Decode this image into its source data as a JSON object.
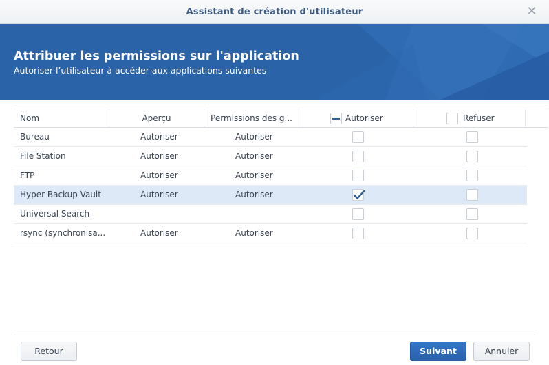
{
  "window": {
    "title": "Assistant de création d'utilisateur",
    "close_icon": "close-icon"
  },
  "banner": {
    "title": "Attribuer les permissions sur l'application",
    "subtitle": "Autoriser l’utilisateur à accéder aux applications suivantes",
    "color": "#2a63a8"
  },
  "table": {
    "headers": {
      "name": "Nom",
      "apercu": "Aperçu",
      "group_permissions": "Permissions des g...",
      "allow": "Autoriser",
      "deny": "Refuser"
    },
    "header_allow_state": "indeterminate",
    "header_deny_state": "unchecked",
    "rows": [
      {
        "name": "Bureau",
        "apercu": "Autoriser",
        "group_perm": "Autoriser",
        "allow": false,
        "deny": false,
        "selected": false
      },
      {
        "name": "File Station",
        "apercu": "Autoriser",
        "group_perm": "Autoriser",
        "allow": false,
        "deny": false,
        "selected": false
      },
      {
        "name": "FTP",
        "apercu": "Autoriser",
        "group_perm": "Autoriser",
        "allow": false,
        "deny": false,
        "selected": false
      },
      {
        "name": "Hyper Backup Vault",
        "apercu": "Autoriser",
        "group_perm": "Autoriser",
        "allow": true,
        "deny": false,
        "selected": true
      },
      {
        "name": "Universal Search",
        "apercu": "",
        "group_perm": "",
        "allow": false,
        "deny": false,
        "selected": false
      },
      {
        "name": "rsync (synchronisa...",
        "apercu": "Autoriser",
        "group_perm": "Autoriser",
        "allow": false,
        "deny": false,
        "selected": false
      }
    ]
  },
  "buttons": {
    "back": "Retour",
    "next": "Suivant",
    "cancel": "Annuler"
  },
  "colors": {
    "accent": "#2a63a8",
    "selected_row": "#dde9f7",
    "check": "#2d5e98"
  }
}
